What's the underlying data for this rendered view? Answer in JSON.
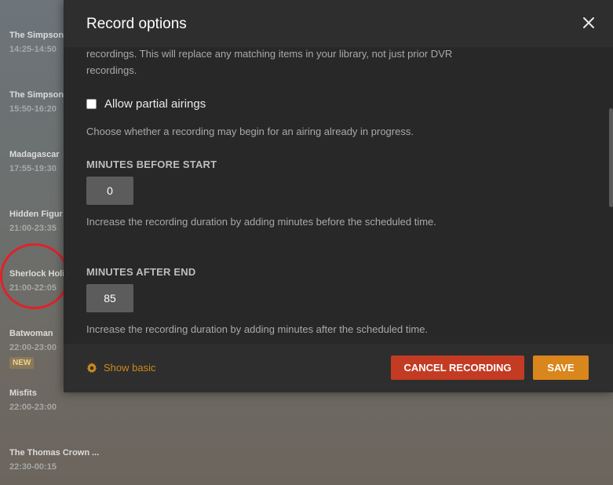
{
  "guide": {
    "items": [
      {
        "title": "The Simpson",
        "time": "14:25-14:50"
      },
      {
        "title": "The Simpson",
        "time": "15:50-16:20"
      },
      {
        "title": "Madagascar",
        "time": "17:55-19:30"
      },
      {
        "title": "Hidden Figur",
        "time": "21:00-23:35"
      },
      {
        "title": "Sherlock Holi",
        "time": "21:00-22:05"
      },
      {
        "title": "Batwoman",
        "time": "22:00-23:00",
        "badge": "NEW"
      },
      {
        "title": "Misfits",
        "time": "22:00-23:00"
      },
      {
        "title": "The Thomas Crown ...",
        "time": "22:30-00:15"
      }
    ]
  },
  "modal": {
    "title": "Record options",
    "close_icon": "close-icon",
    "intro_text": "recordings. This will replace any matching items in your library, not just prior DVR recordings.",
    "partial_airings": {
      "label": "Allow partial airings",
      "checked": false,
      "description": "Choose whether a recording may begin for an airing already in progress."
    },
    "minutes_before": {
      "label": "MINUTES BEFORE START",
      "value": "0",
      "description": "Increase the recording duration by adding minutes before the scheduled time."
    },
    "minutes_after": {
      "label": "MINUTES AFTER END",
      "value": "85",
      "description": "Increase the recording duration by adding minutes after the scheduled time."
    },
    "footer": {
      "show_basic": "Show basic",
      "cancel_recording": "CANCEL RECORDING",
      "save": "SAVE"
    }
  },
  "colors": {
    "accent": "#d9861d",
    "danger": "#c33b22",
    "annotation_circle": "#e0222a"
  }
}
